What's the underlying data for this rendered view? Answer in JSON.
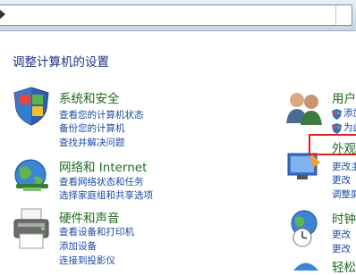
{
  "page": {
    "title": "调整计算机的设置"
  },
  "categories_left": [
    {
      "title": "系统和安全",
      "icon": "shield-flag-icon",
      "links": [
        "查看您的计算机状态",
        "备份您的计算机",
        "查找并解决问题"
      ]
    },
    {
      "title": "网络和 Internet",
      "icon": "network-globe-icon",
      "links": [
        "查看网络状态和任务",
        "选择家庭组和共享选项"
      ]
    },
    {
      "title": "硬件和声音",
      "icon": "printer-icon",
      "links": [
        "查看设备和打印机",
        "添加设备",
        "连接到投影仪"
      ]
    }
  ],
  "categories_right": [
    {
      "title": "用户",
      "icon": "users-icon",
      "links": [
        "添加",
        "为此"
      ]
    },
    {
      "title": "外观",
      "icon": "appearance-icon",
      "links": [
        "更改主",
        "更改",
        "调整屏"
      ]
    },
    {
      "title": "时钟",
      "icon": "clock-globe-icon",
      "links": [
        "更改",
        "更改"
      ]
    },
    {
      "title": "轻松",
      "icon": "ease-access-icon",
      "links": []
    }
  ],
  "colors": {
    "category": "#1e6b1e",
    "link": "#1a4aa4",
    "highlight": "#d92323",
    "title": "#1e3287"
  }
}
